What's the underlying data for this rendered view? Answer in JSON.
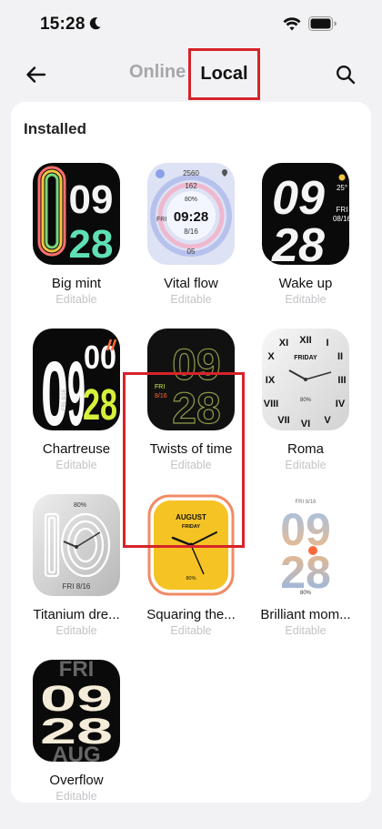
{
  "status_bar": {
    "time": "15:28"
  },
  "nav": {
    "tab_online": "Online",
    "tab_local": "Local"
  },
  "section": {
    "title": "Installed"
  },
  "faces": [
    {
      "name": "Big mint",
      "sub": "Editable",
      "face_text": {
        "hour": "09",
        "minute": "28"
      }
    },
    {
      "name": "Vital flow",
      "sub": "Editable",
      "face_text": {
        "steps": "2560",
        "top": "162",
        "battery": "80%",
        "day": "FRI",
        "time": "09:28",
        "date": "8/16",
        "bottom": "05"
      }
    },
    {
      "name": "Wake up",
      "sub": "Editable",
      "face_text": {
        "hour": "09",
        "minute": "28",
        "temp": "25°",
        "day": "FRI",
        "date": "08/16"
      }
    },
    {
      "name": "Chartreuse",
      "sub": "Editable",
      "face_text": {
        "h1": "0",
        "h2": "9",
        "m1": "00",
        "m2": "28",
        "side": "FRI 8/16"
      }
    },
    {
      "name": "Twists of time",
      "sub": "Editable",
      "face_text": {
        "hour": "09",
        "minute": "28",
        "day": "FRI",
        "date": "8/16"
      }
    },
    {
      "name": "Roma",
      "sub": "Editable",
      "face_text": {
        "day": "FRIDAY",
        "battery": "80%"
      }
    },
    {
      "name": "Titanium dre...",
      "sub": "Editable",
      "face_text": {
        "battery": "80%",
        "date": "FRI 8/16"
      }
    },
    {
      "name": "Squaring the...",
      "sub": "Editable",
      "face_text": {
        "month": "AUGUST",
        "day": "FRIDAY",
        "battery": "80%"
      }
    },
    {
      "name": "Brilliant mom...",
      "sub": "Editable",
      "face_text": {
        "date": "FRI 8/16",
        "hour": "09",
        "minute": "28",
        "battery": "80%"
      }
    },
    {
      "name": "Overflow",
      "sub": "Editable",
      "face_text": {
        "day": "FRI",
        "hour": "09",
        "minute": "28",
        "month": "AUG"
      }
    }
  ]
}
